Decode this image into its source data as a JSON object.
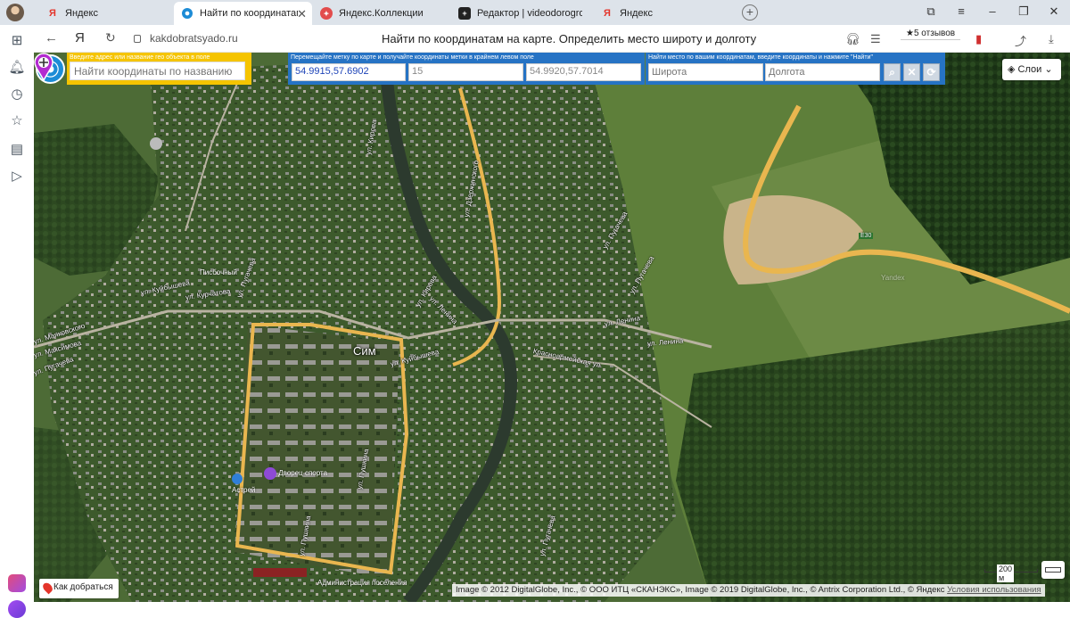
{
  "tabs": [
    {
      "label": "Яндекс",
      "icon": "yandex-icon",
      "active": false
    },
    {
      "label": "Найти по координатам",
      "icon": "globe-icon",
      "active": true
    },
    {
      "label": "Яндекс.Коллекции",
      "icon": "collections-icon",
      "active": false
    },
    {
      "label": "Редактор | videodorogross",
      "icon": "editor-icon",
      "active": false
    },
    {
      "label": "Яндекс",
      "icon": "yandex-icon",
      "active": false
    }
  ],
  "addressbar": {
    "url": "kakdobratsyado.ru",
    "page_title": "Найти по координатам на карте. Определить место широту и долготу",
    "reviews": "5 отзывов"
  },
  "search_by_name": {
    "label": "Введите адрес или название гео объекта в поле",
    "placeholder": "Найти координаты по названию"
  },
  "marker_panel": {
    "label": "Перемещайте метку по карте и получайте координаты метки в крайнем левом поле",
    "marker_coords": "54.9915,57.6902",
    "zoom": "15",
    "center_coords": "54.9920,57.7014"
  },
  "find_panel": {
    "label": "Найти место по вашим координатам, введите координаты и нажмите \"Найти\"",
    "lat_placeholder": "Широта",
    "lon_placeholder": "Долгота"
  },
  "map": {
    "layers_label": "Слои",
    "town": "Сим",
    "streets": [
      "ул. Куйбышева",
      "ул. Кирова",
      "ул. Куйбышева",
      "ул. Пугачева",
      "ул. Маяковского",
      "ул. Пушкина",
      "ул. Ленина",
      "ул. Ленина",
      "ул. Курчатова",
      "ул. Кирова",
      "ул. Пушкина",
      "ул. Пугачева",
      "ул. Дзержинского",
      "ул. Пугачева",
      "ул. Пугачева",
      "ул. Ленина",
      "ул. Максимова",
      "ул. Пугачева"
    ],
    "pois": [
      "Писбочный",
      "Дворец спорта",
      "Астрей",
      "Администрация поселения",
      "Красноармейская ул.",
      "E30",
      "Yandex"
    ],
    "route_label": "Как добраться",
    "scale": "200 м",
    "copyright": "Image © 2012 DigitalGlobe, Inc., © ООО ИТЦ «СКАНЭКС», Image © 2019 DigitalGlobe, Inc., © Antrix Corporation Ltd., © Яндекс",
    "terms": "Условия использования"
  },
  "colors": {
    "accent_blue": "#2673c4",
    "accent_yellow": "#f5c400",
    "road_yellow": "#e9b64f",
    "river": "#2c3a2e"
  }
}
